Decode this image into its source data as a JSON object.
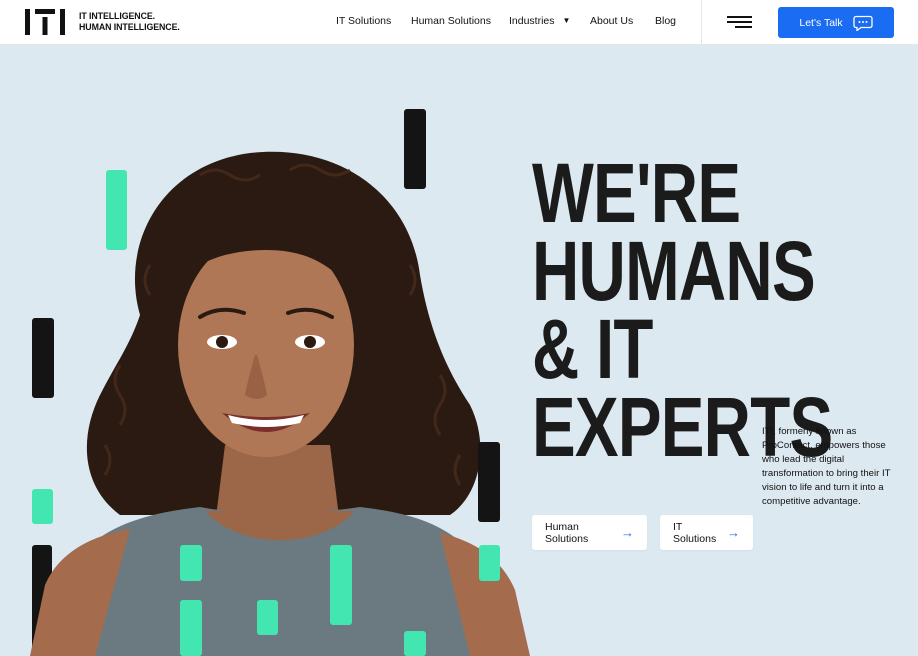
{
  "brand": {
    "logo_line1": "IT INTELLIGENCE.",
    "logo_line2": "HUMAN INTELLIGENCE."
  },
  "nav": {
    "items": [
      {
        "label": "IT Solutions"
      },
      {
        "label": "Human Solutions"
      },
      {
        "label": "Industries"
      },
      {
        "label": "About Us"
      },
      {
        "label": "Blog"
      }
    ],
    "menu_icon": "hamburger-icon",
    "cta_label": "Let's Talk",
    "cta_icon": "chat-bubble-icon"
  },
  "hero": {
    "headline": [
      "WE'RE",
      "HUMANS",
      "& IT",
      "EXPERTS"
    ],
    "description": "ITI, formerly known as ProContact, empowers those who lead the digital transformation to bring their IT vision to life and turn it into a competitive advantage.",
    "buttons": [
      {
        "label": "Human Solutions",
        "icon": "arrow-right-icon"
      },
      {
        "label": "IT Solutions",
        "icon": "arrow-right-icon"
      }
    ]
  },
  "colors": {
    "accent": "#1a6cf2",
    "background": "#dde9f1",
    "green_bar": "#43e6b0",
    "dark_bar": "#141414"
  }
}
